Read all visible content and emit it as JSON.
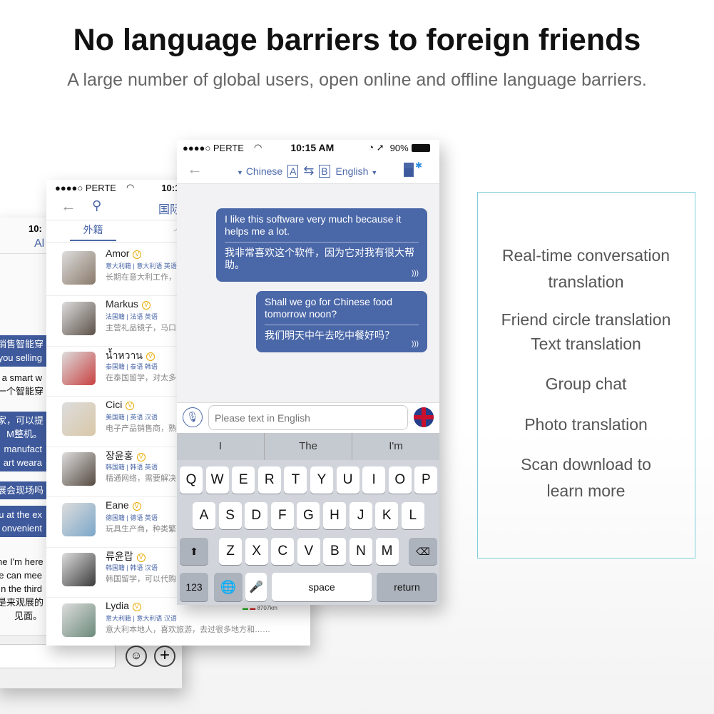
{
  "header": {
    "title": "No language barriers to foreign friends",
    "subtitle": "A large number of global users, open online and offline language barriers."
  },
  "back_phone": {
    "time": "10:",
    "nav_partial": "Al",
    "bubbles": [
      "销售智能穿",
      "you selling",
      "a smart w",
      "一个智能穿",
      "家，可以提",
      "M整机。",
      "manufact",
      "art weara",
      "展会现场吗",
      "u at the ex",
      "onvenient",
      "ne I'm here",
      "e can mee",
      "n the third",
      "是来观展的",
      "见面。"
    ],
    "icons": [
      "emoji-icon",
      "plus-icon"
    ]
  },
  "middle_phone": {
    "carrier": "●●●●○ PERTE",
    "time": "10:1",
    "nav_title_partial": "国际",
    "tab_active": "外籍",
    "tab_next_partial": "个",
    "distance": "8707km",
    "contacts": [
      {
        "name": "Amor",
        "nationality": "意大利籍 | 意大利语 英语",
        "desc": "长期在意大利工作，",
        "color": "#8a7a6a"
      },
      {
        "name": "Markus",
        "nationality": "法国籍 | 法语 英语",
        "desc": "主营礼品镜子，马口",
        "color": "#5b5048"
      },
      {
        "name": "น้ำหวาน",
        "nationality": "泰国籍 | 泰语 韩语",
        "desc": "在泰国留学，对太多",
        "color": "#c94040"
      },
      {
        "name": "Cici",
        "nationality": "美国籍 | 英语 汉语",
        "desc": "电子产品销售商，熟",
        "color": "#d9c7a8"
      },
      {
        "name": "장윤홍",
        "nationality": "韩国籍 | 韩语 英语",
        "desc": "精通网络，需要解决",
        "color": "#554a40"
      },
      {
        "name": "Eane",
        "nationality": "德国籍 | 德语 英语",
        "desc": "玩具生产商，种类繁",
        "color": "#7aa6c8"
      },
      {
        "name": "류윤랍",
        "nationality": "韩国籍 | 韩语 汉语",
        "desc": "韩国留学，可以代购",
        "color": "#3a3a3a"
      },
      {
        "name": "Lydia",
        "nationality": "意大利籍 | 意大利语 汉语",
        "desc": "意大利本地人，喜欢旅游，去过很多地方和……",
        "color": "#6b8a7a"
      }
    ]
  },
  "front_phone": {
    "carrier": "●●●●○ PERTE",
    "time": "10:15 AM",
    "battery": "90%",
    "source_lang": "Chinese",
    "source_badge": "A",
    "target_badge": "B",
    "target_lang": "English",
    "messages": [
      {
        "en": "I like this software very much because it helps me a lot.",
        "zh": "我非常喜欢这个软件，因为它对我有很大帮助。"
      },
      {
        "en": "Shall we go for Chinese food tomorrow noon?",
        "zh": "我们明天中午去吃中餐好吗？"
      }
    ],
    "input_placeholder": "Please text in English",
    "suggestions": [
      "I",
      "The",
      "I'm"
    ],
    "keys_row1": [
      "Q",
      "W",
      "E",
      "R",
      "T",
      "Y",
      "U",
      "I",
      "O",
      "P"
    ],
    "keys_row2": [
      "A",
      "S",
      "D",
      "F",
      "G",
      "H",
      "J",
      "K",
      "L"
    ],
    "keys_row3": [
      "Z",
      "X",
      "C",
      "V",
      "B",
      "N",
      "M"
    ],
    "key_123": "123",
    "key_space": "space",
    "key_return": "return"
  },
  "features": [
    "Real-time conversation translation",
    "Friend circle translation",
    "Text translation",
    "Group chat",
    "Photo translation",
    "Scan download to learn more"
  ],
  "colors": {
    "accent": "#4a67a8",
    "box_border": "#7dcfd8"
  }
}
